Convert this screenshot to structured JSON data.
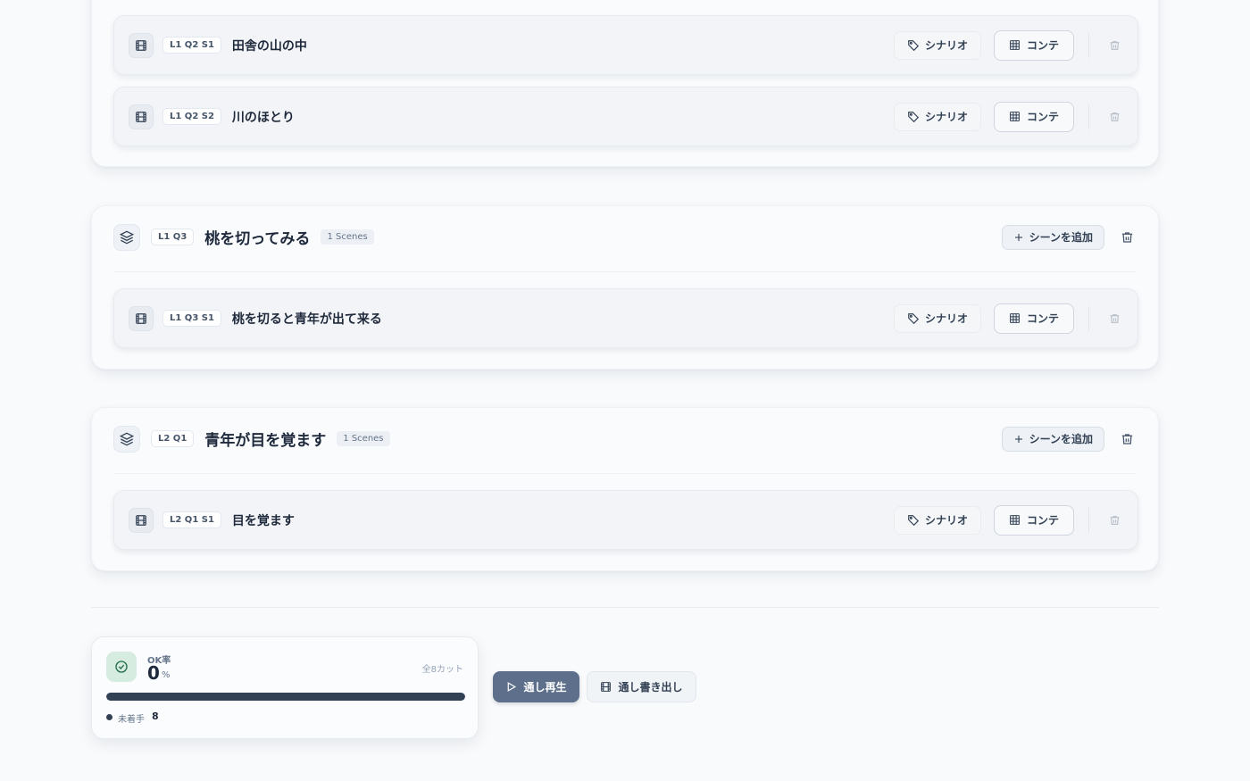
{
  "question_cards": [
    {
      "code": "",
      "title": "",
      "scenes": [
        {
          "code": "L1 Q2 S1",
          "title": "田舎の山の中"
        },
        {
          "code": "L1 Q2 S2",
          "title": "川のほとり"
        }
      ]
    },
    {
      "code": "L1 Q3",
      "title": "桃を切ってみる",
      "scene_count": "1 Scenes",
      "add_scene_label": "シーンを追加",
      "scenes": [
        {
          "code": "L1 Q3 S1",
          "title": "桃を切ると青年が出て来る"
        }
      ]
    },
    {
      "code": "L2 Q1",
      "title": "青年が目を覚ます",
      "scene_count": "1 Scenes",
      "add_scene_label": "シーンを追加",
      "scenes": [
        {
          "code": "L2 Q1 S1",
          "title": "目を覚ます"
        }
      ]
    }
  ],
  "scene_actions": {
    "scenario_label": "シナリオ",
    "conte_label": "コンテ"
  },
  "stats": {
    "ok_label": "OK率",
    "ok_value": "0",
    "ok_unit": "%",
    "total_cuts": "全8カット",
    "progress_fraction": 0,
    "legend_label": "未着手",
    "legend_count": "8",
    "colors": {
      "ok_icon_bg": "#d6ece0",
      "ok_icon_fg": "#1f6b45",
      "progress": "#334155"
    }
  },
  "actions": {
    "play_label": "通し再生",
    "export_label": "通し書き出し"
  },
  "colors": {
    "primary_button": "#5d6f8a"
  }
}
